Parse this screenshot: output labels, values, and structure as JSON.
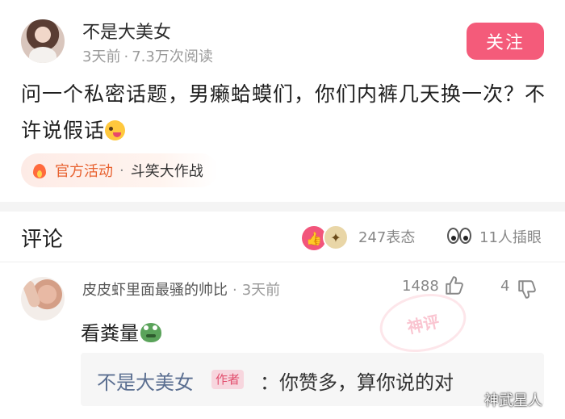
{
  "post": {
    "author": "不是大美女",
    "time": "3天前",
    "views": "7.3万次阅读",
    "follow_label": "关注",
    "title": "问一个私密话题，男癞蛤蟆们，你们内裤几天换一次？不许说假话",
    "activity_label": "官方活动",
    "activity_name": "斗笑大作战"
  },
  "comments_header": {
    "title": "评论",
    "reactions": "247表态",
    "onlookers": "11人插眼"
  },
  "comment": {
    "author": "皮皮虾里面最骚的帅比",
    "time": "3天前",
    "likes": "1488",
    "dislikes": "4",
    "stamp": "神评",
    "text": "看粪量",
    "reply": {
      "author": "不是大美女",
      "badge": "作者",
      "text": "：你赞多，算你说的对"
    }
  },
  "watermark": "神武星人",
  "icons": [
    "flame-icon",
    "thumbs-up-icon",
    "thumbs-down-icon",
    "eyes-icon",
    "laughing-emoji",
    "frog-emoji"
  ],
  "colors": {
    "accent": "#f45b7a",
    "activity": "#e8612f",
    "reply_author": "#5b6f91"
  }
}
